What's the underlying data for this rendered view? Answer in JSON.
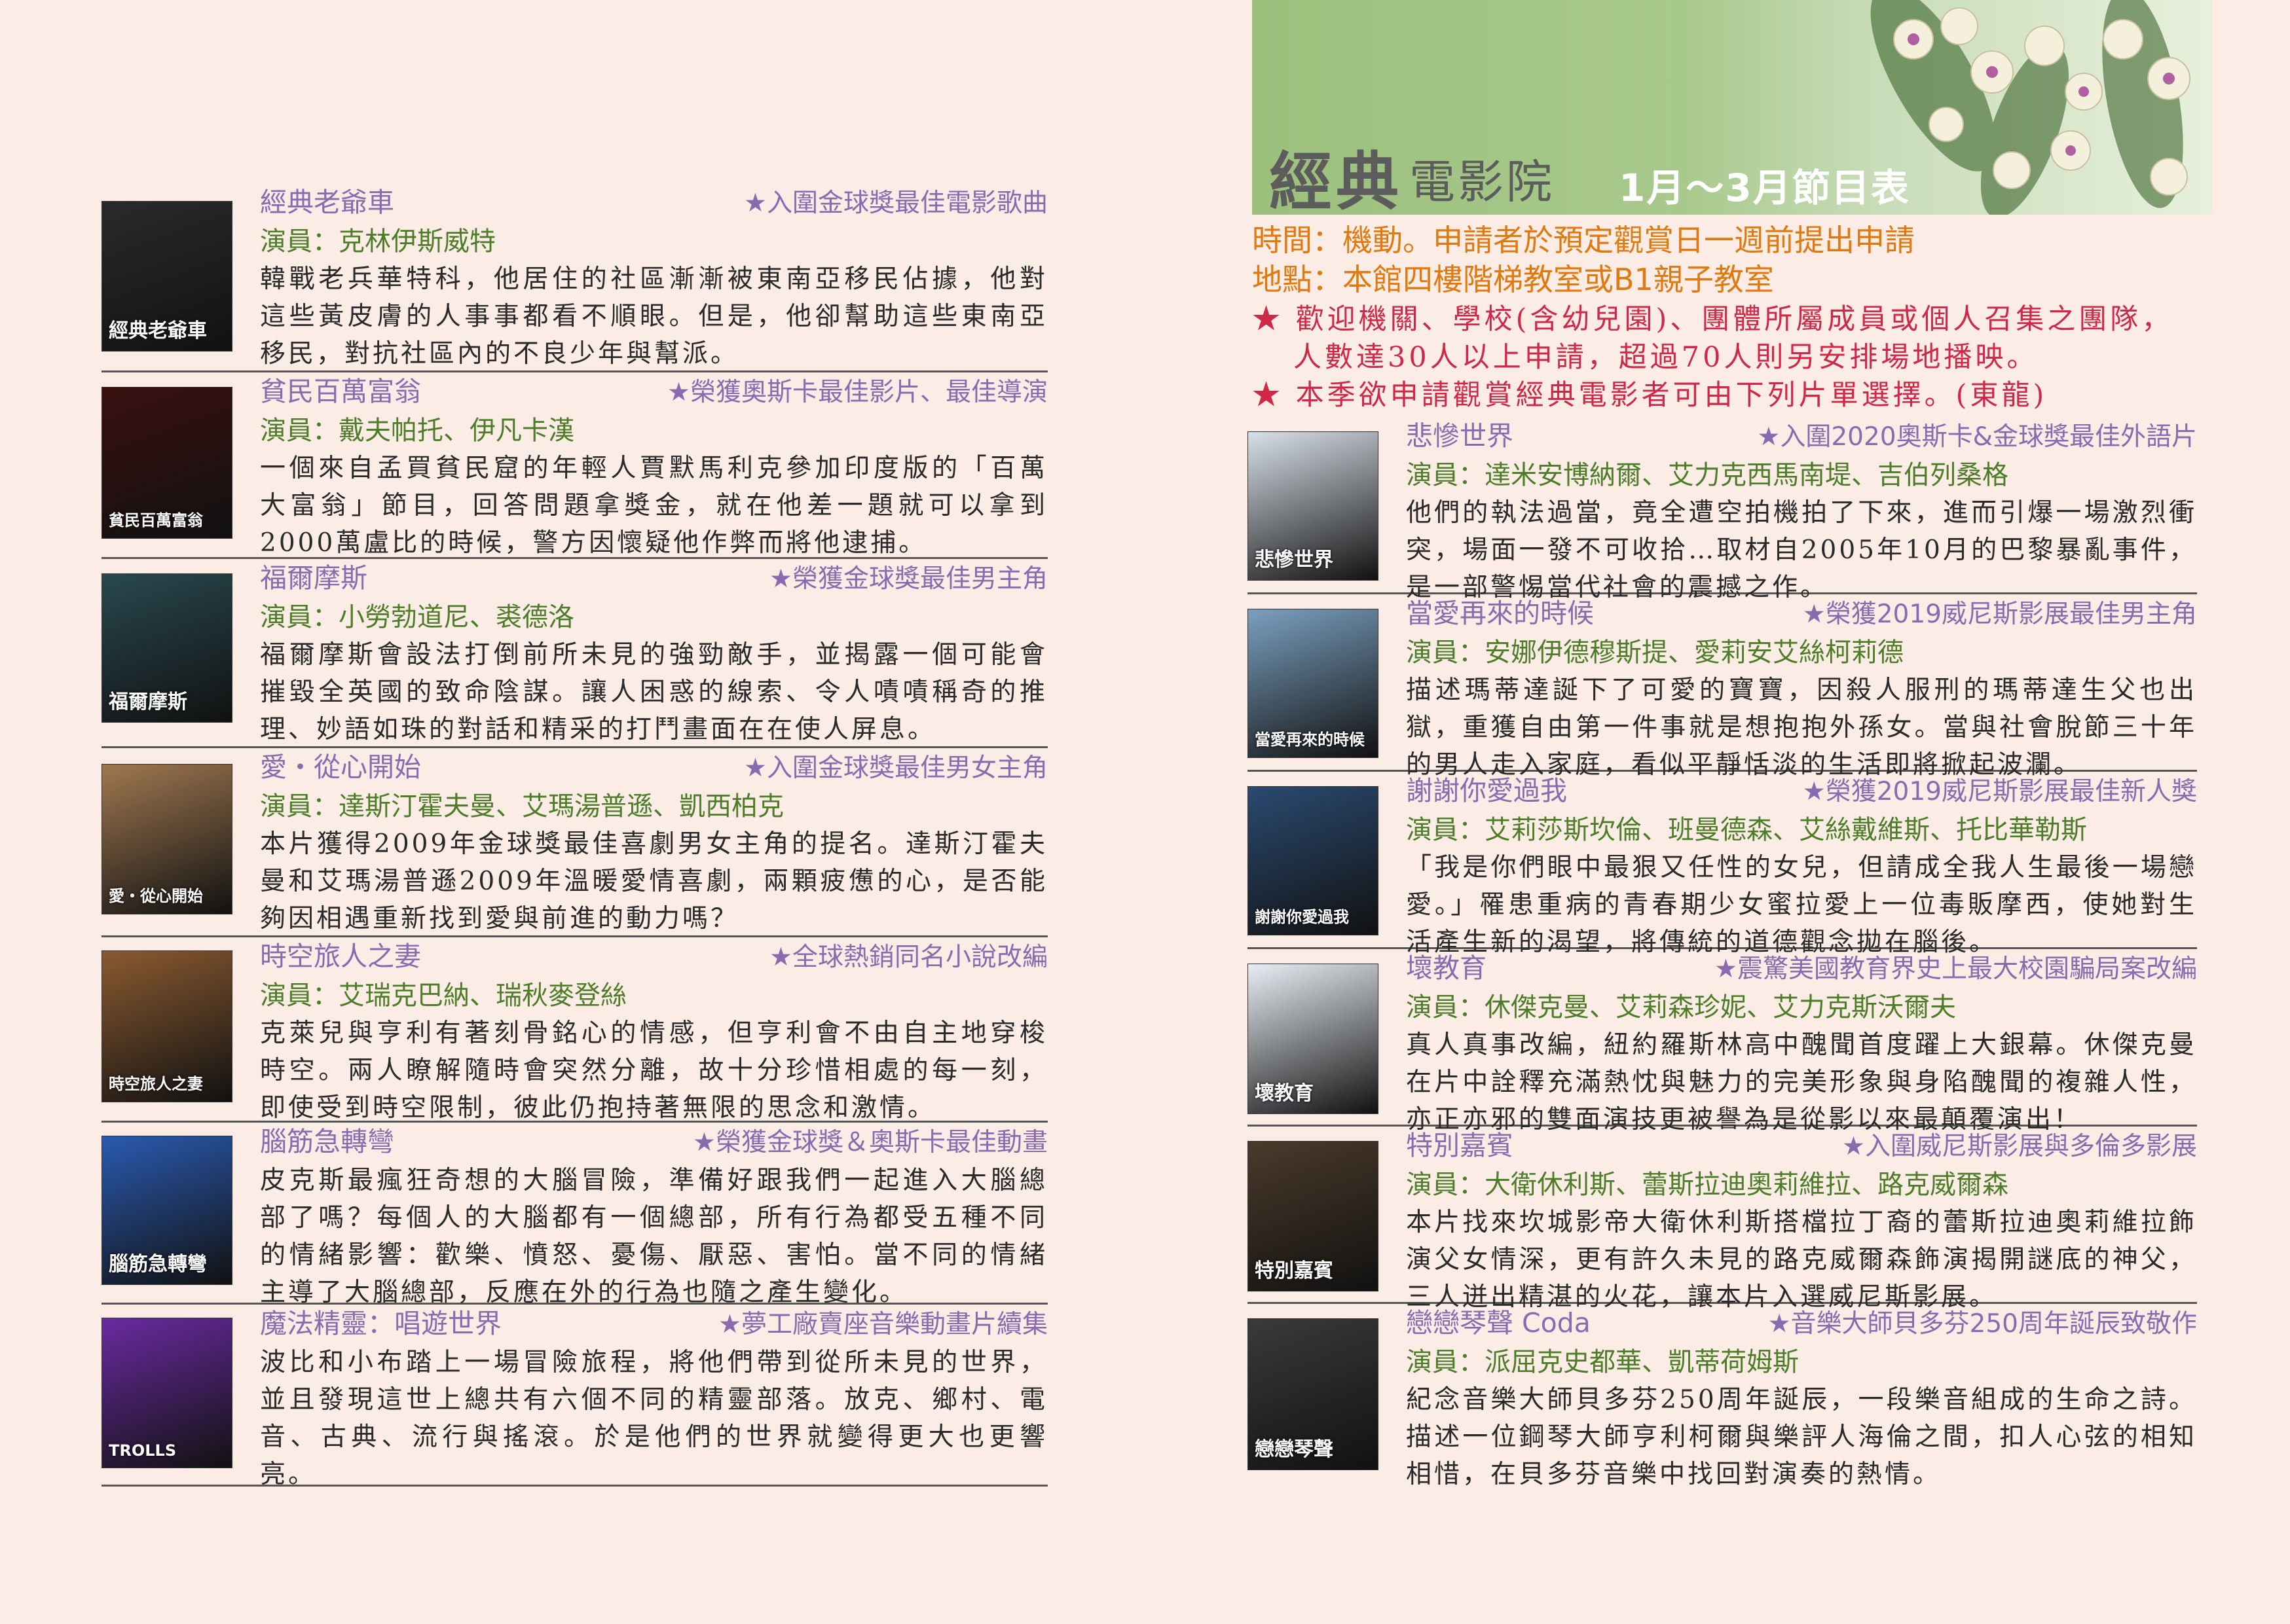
{
  "header": {
    "title_big": "經典",
    "title_mid": "電影院",
    "title_date": "1月～3月節目表"
  },
  "info": {
    "time": "時間：機動。申請者於預定觀賞日一週前提出申請",
    "place": "地點：本館四樓階梯教室或B1親子教室"
  },
  "notices": [
    "★ 歡迎機關、學校(含幼兒園)、團體所屬成員或個人召集之團隊，",
    "人數達30人以上申請，超過70人則另安排場地播映。",
    "★ 本季欲申請觀賞經典電影者可由下列片單選擇。(東龍)"
  ],
  "left_films": [
    {
      "title": "經典老爺車",
      "award": "★入圍金球獎最佳電影歌曲",
      "cast": "演員：克林伊斯威特",
      "desc": "韓戰老兵華特科，他居住的社區漸漸被東南亞移民佔據，他對這些黃皮膚的人事事都看不順眼。但是，他卻幫助這些東南亞移民，對抗社區內的不良少年與幫派。",
      "poster_text": "經典老爺車",
      "poster_color": "#2a2a2a"
    },
    {
      "title": "貧民百萬富翁",
      "award": "★榮獲奧斯卡最佳影片、最佳導演",
      "cast": "演員：戴夫帕托、伊凡卡漢",
      "desc": "一個來自孟買貧民窟的年輕人賈默馬利克參加印度版的「百萬大富翁」節目，回答問題拿獎金，就在他差一題就可以拿到2000萬盧比的時候，警方因懷疑他作弊而將他逮捕。",
      "poster_text": "貧民百萬富翁",
      "poster_color": "#3a1010"
    },
    {
      "title": "福爾摩斯",
      "award": "★榮獲金球獎最佳男主角",
      "cast": "演員：小勞勃道尼、裘德洛",
      "desc": "福爾摩斯會設法打倒前所未見的強勁敵手，並揭露一個可能會摧毀全英國的致命陰謀。讓人困惑的線索、令人嘖嘖稱奇的推理、妙語如珠的對話和精采的打鬥畫面在在使人屏息。",
      "poster_text": "福爾摩斯",
      "poster_color": "#28484e"
    },
    {
      "title": "愛・從心開始",
      "award": "★入圍金球獎最佳男女主角",
      "cast": "演員：達斯汀霍夫曼、艾瑪湯普遜、凱西柏克",
      "desc": "本片獲得2009年金球獎最佳喜劇男女主角的提名。達斯汀霍夫曼和艾瑪湯普遜2009年溫暖愛情喜劇，兩顆疲憊的心，是否能夠因相遇重新找到愛與前進的動力嗎？",
      "poster_text": "愛・從心開始",
      "poster_color": "#a07850"
    },
    {
      "title": "時空旅人之妻",
      "award": "★全球熱銷同名小說改編",
      "cast": "演員：艾瑞克巴納、瑞秋麥登絲",
      "desc": "克萊兒與亨利有著刻骨銘心的情感，但亨利會不由自主地穿梭時空。兩人瞭解隨時會突然分離，故十分珍惜相處的每一刻，即使受到時空限制，彼此仍抱持著無限的思念和激情。",
      "poster_text": "時空旅人之妻",
      "poster_color": "#8a5a30"
    },
    {
      "title": "腦筋急轉彎",
      "award": "★榮獲金球獎＆奧斯卡最佳動畫",
      "cast": "",
      "desc": "皮克斯最瘋狂奇想的大腦冒險，準備好跟我們一起進入大腦總部了嗎？每個人的大腦都有一個總部，所有行為都受五種不同的情緒影響：歡樂、憤怒、憂傷、厭惡、害怕。當不同的情緒主導了大腦總部，反應在外的行為也隨之產生變化。",
      "poster_text": "腦筋急轉彎",
      "poster_color": "#2a5ab0"
    },
    {
      "title": "魔法精靈：唱遊世界",
      "award": "★夢工廠賣座音樂動畫片續集",
      "cast": "",
      "desc": "波比和小布踏上一場冒險旅程，將他們帶到從所未見的世界，並且發現這世上總共有六個不同的精靈部落。放克、鄉村、電音、古典、流行與搖滾。於是他們的世界就變得更大也更響亮。",
      "poster_text": "TROLLS",
      "poster_color": "#6a2aa0"
    }
  ],
  "right_films": [
    {
      "title": "悲慘世界",
      "award": "★入圍2020奧斯卡&金球獎最佳外語片",
      "cast": "演員：達米安博納爾、艾力克西馬南堤、吉伯列桑格",
      "desc": "他們的執法過當，竟全遭空拍機拍了下來，進而引爆一場激烈衝突，場面一發不可收拾…取材自2005年10月的巴黎暴亂事件，是一部警惕當代社會的震撼之作。",
      "poster_text": "悲慘世界",
      "poster_color": "#d8e0e8"
    },
    {
      "title": "當愛再來的時候",
      "award": "★榮獲2019威尼斯影展最佳男主角",
      "cast": "演員：安娜伊德穆斯提、愛莉安艾絲柯莉德",
      "desc": "描述瑪蒂達誕下了可愛的寶寶，因殺人服刑的瑪蒂達生父也出獄，重獲自由第一件事就是想抱抱外孫女。當與社會脫節三十年的男人走入家庭，看似平靜恬淡的生活即將掀起波瀾。",
      "poster_text": "當愛再來的時候",
      "poster_color": "#7aa0c0"
    },
    {
      "title": "謝謝你愛過我",
      "award": "★榮獲2019威尼斯影展最佳新人獎",
      "cast": "演員：艾莉莎斯坎倫、班曼德森、艾絲戴維斯、托比華勒斯",
      "desc": "「我是你們眼中最狠又任性的女兒，但請成全我人生最後一場戀愛。」罹患重病的青春期少女蜜拉愛上一位毒販摩西，使她對生活產生新的渴望，將傳統的道德觀念拋在腦後。",
      "poster_text": "謝謝你愛過我",
      "poster_color": "#2a4a70"
    },
    {
      "title": "壞教育",
      "award": "★震驚美國教育界史上最大校園騙局案改編",
      "cast": "演員：休傑克曼、艾莉森珍妮、艾力克斯沃爾夫",
      "desc": "真人真事改編，紐約羅斯林高中醜聞首度躍上大銀幕。休傑克曼在片中詮釋充滿熱忱與魅力的完美形象與身陷醜聞的複雜人性，亦正亦邪的雙面演技更被譽為是從影以來最顛覆演出！",
      "poster_text": "壞教育",
      "poster_color": "#e8eef4"
    },
    {
      "title": "特別嘉賓",
      "award": "★入圍威尼斯影展與多倫多影展",
      "cast": "演員：大衛休利斯、蕾斯拉迪奧莉維拉、路克威爾森",
      "desc": "本片找來坎城影帝大衛休利斯搭檔拉丁裔的蕾斯拉迪奧莉維拉飾演父女情深，更有許久未見的路克威爾森飾演揭開謎底的神父，三人迸出精湛的火花，讓本片入選威尼斯影展。",
      "poster_text": "特別嘉賓",
      "poster_color": "#4a3a2a"
    },
    {
      "title": "戀戀琴聲 Coda",
      "award": "★音樂大師貝多芬250周年誕辰致敬作",
      "cast": "演員：派屈克史都華、凱蒂荷姆斯",
      "desc": "紀念音樂大師貝多芬250周年誕辰，一段樂音組成的生命之詩。描述一位鋼琴大師亨利柯爾與樂評人海倫之間，扣人心弦的相知相惜，在貝多芬音樂中找回對演奏的熱情。",
      "poster_text": "戀戀琴聲",
      "poster_color": "#3a3a3a"
    }
  ]
}
